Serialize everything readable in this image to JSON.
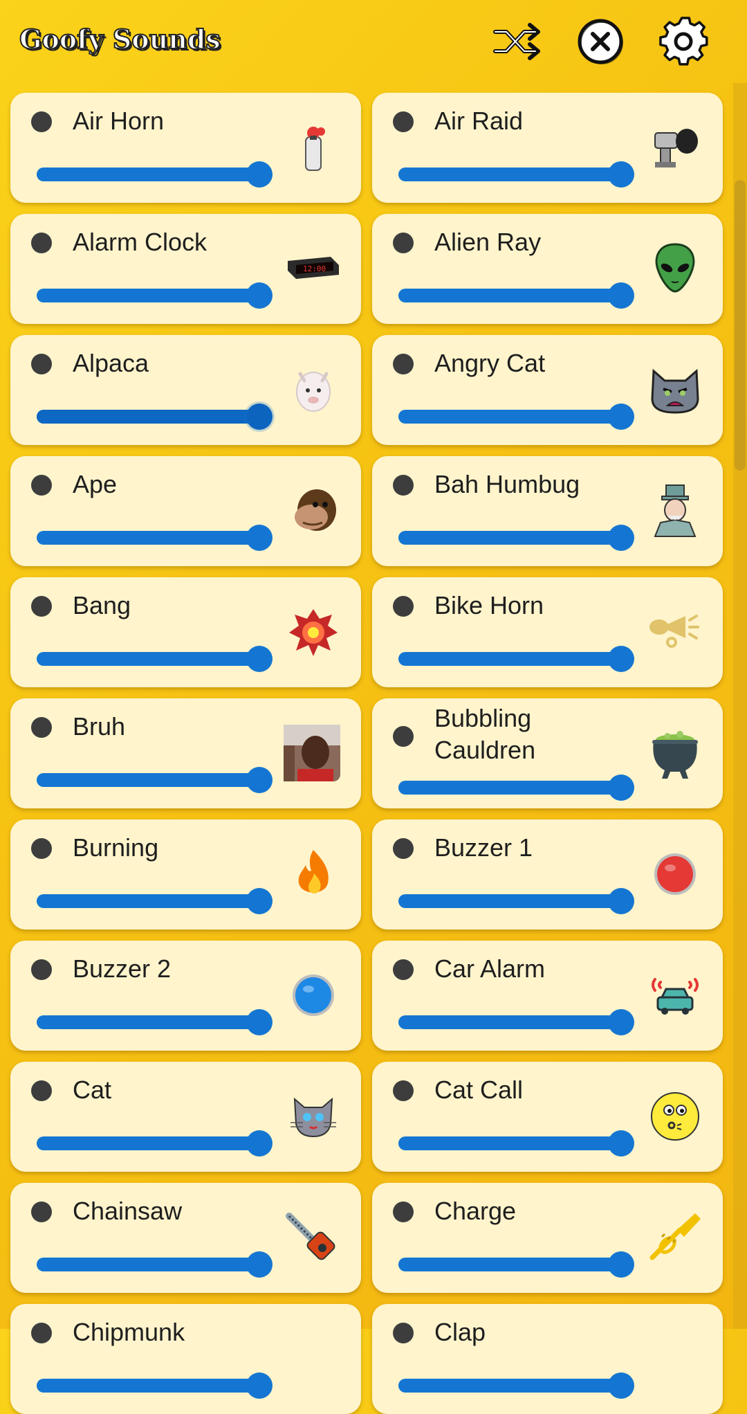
{
  "app": {
    "title": "Goofy Sounds"
  },
  "header": {
    "shuffle_icon": "shuffle-icon",
    "stop_icon": "stop-all-icon",
    "settings_icon": "gear-icon"
  },
  "colors": {
    "background": "#f6c313",
    "card": "#fff4cc",
    "slider": "#1476d2",
    "dot": "#3d3d3d"
  },
  "sounds": [
    {
      "label": "Air Horn",
      "icon": "air-horn-icon",
      "volume": 1.0
    },
    {
      "label": "Air Raid",
      "icon": "siren-icon",
      "volume": 1.0
    },
    {
      "label": "Alarm Clock",
      "icon": "alarm-clock-icon",
      "volume": 1.0
    },
    {
      "label": "Alien Ray",
      "icon": "alien-icon",
      "volume": 1.0
    },
    {
      "label": "Alpaca",
      "icon": "alpaca-icon",
      "volume": 1.0,
      "active": true
    },
    {
      "label": "Angry Cat",
      "icon": "angry-cat-icon",
      "volume": 1.0
    },
    {
      "label": "Ape",
      "icon": "ape-icon",
      "volume": 1.0
    },
    {
      "label": "Bah Humbug",
      "icon": "scrooge-icon",
      "volume": 1.0
    },
    {
      "label": "Bang",
      "icon": "explosion-icon",
      "volume": 1.0
    },
    {
      "label": "Bike Horn",
      "icon": "bike-horn-icon",
      "volume": 1.0
    },
    {
      "label": "Bruh",
      "icon": "bruh-photo-icon",
      "volume": 1.0
    },
    {
      "label": "Bubbling Cauldren",
      "icon": "cauldron-icon",
      "volume": 1.0
    },
    {
      "label": "Burning",
      "icon": "fire-icon",
      "volume": 1.0
    },
    {
      "label": "Buzzer 1",
      "icon": "red-buzzer-icon",
      "volume": 1.0
    },
    {
      "label": "Buzzer 2",
      "icon": "blue-buzzer-icon",
      "volume": 1.0
    },
    {
      "label": "Car Alarm",
      "icon": "car-alarm-icon",
      "volume": 1.0
    },
    {
      "label": "Cat",
      "icon": "cat-icon",
      "volume": 1.0
    },
    {
      "label": "Cat Call",
      "icon": "whistling-face-icon",
      "volume": 1.0
    },
    {
      "label": "Chainsaw",
      "icon": "chainsaw-icon",
      "volume": 1.0
    },
    {
      "label": "Charge",
      "icon": "trumpet-icon",
      "volume": 1.0
    },
    {
      "label": "Chipmunk",
      "icon": "chipmunk-icon",
      "volume": 1.0
    },
    {
      "label": "Clap",
      "icon": "clap-icon",
      "volume": 1.0
    }
  ]
}
